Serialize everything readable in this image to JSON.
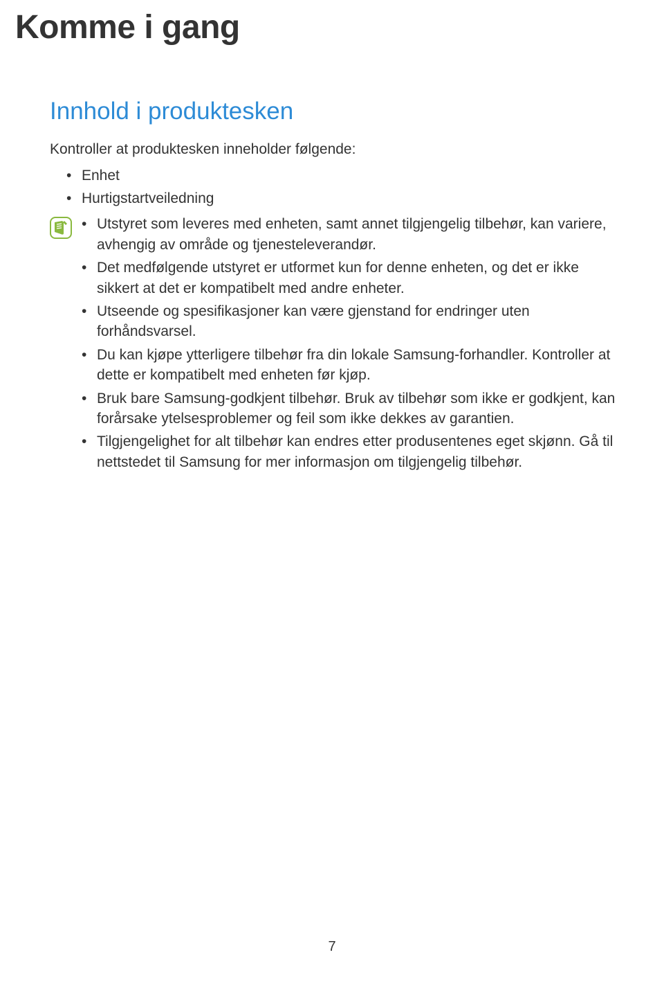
{
  "page_title": "Komme i gang",
  "section_title": "Innhold i produktesken",
  "intro_text": "Kontroller at produktesken inneholder følgende:",
  "simple_items": [
    "Enhet",
    "Hurtigstartveiledning"
  ],
  "note_items": [
    "Utstyret som leveres med enheten, samt annet tilgjengelig tilbehør, kan variere, avhengig av område og tjenesteleverandør.",
    "Det medfølgende utstyret er utformet kun for denne enheten, og det er ikke sikkert at det er kompatibelt med andre enheter.",
    "Utseende og spesifikasjoner kan være gjenstand for endringer uten forhåndsvarsel.",
    "Du kan kjøpe ytterligere tilbehør fra din lokale Samsung-forhandler. Kontroller at dette er kompatibelt med enheten før kjøp.",
    "Bruk bare Samsung-godkjent tilbehør. Bruk av tilbehør som ikke er godkjent, kan forårsake ytelsesproblemer og feil som ikke dekkes av garantien.",
    "Tilgjengelighet for alt tilbehør kan endres etter produsentenes eget skjønn. Gå til nettstedet til Samsung for mer informasjon om tilgjengelig tilbehør."
  ],
  "page_number": "7"
}
